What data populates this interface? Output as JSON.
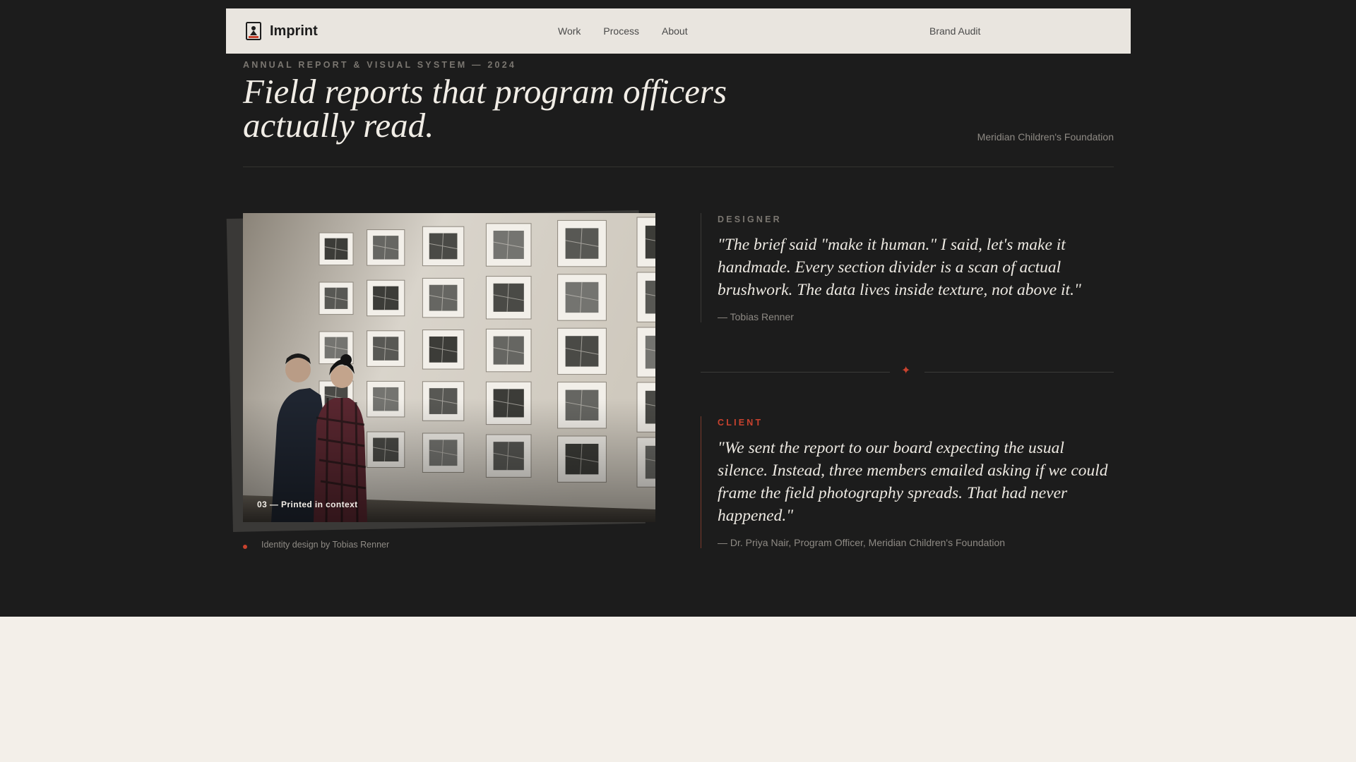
{
  "nav": {
    "brand_name": "Imprint",
    "links": [
      "Work",
      "Process",
      "About"
    ],
    "cta": "Brand Audit"
  },
  "header": {
    "eyebrow": "ANNUAL REPORT & VISUAL SYSTEM — 2024",
    "headline_line1": "Field reports that program officers",
    "headline_line2": "actually read.",
    "client": "Meridian Children's Foundation"
  },
  "image": {
    "caption": "03 — Printed in context",
    "credit": "Identity design by Tobias Renner"
  },
  "designer": {
    "label": "DESIGNER",
    "quote": "\"The brief said \"make it human.\" I said, let's make it handmade. Every section divider is a scan of actual brushwork. The data lives inside texture, not above it.\"",
    "attribution": "— Tobias Renner"
  },
  "divider_glyph": "✦",
  "client": {
    "label": "CLIENT",
    "quote": "\"We sent the report to our board expecting the usual silence. Instead, three members emailed asking if we could frame the field photography spreads. That had never happened.\"",
    "attribution": "— Dr. Priya Nair, Program Officer, Meridian Children's Foundation"
  },
  "colors": {
    "accent": "#c9422e",
    "dark_bg": "#1c1c1c",
    "light_bg": "#f3efe9",
    "nav_bg": "#e9e5df"
  }
}
